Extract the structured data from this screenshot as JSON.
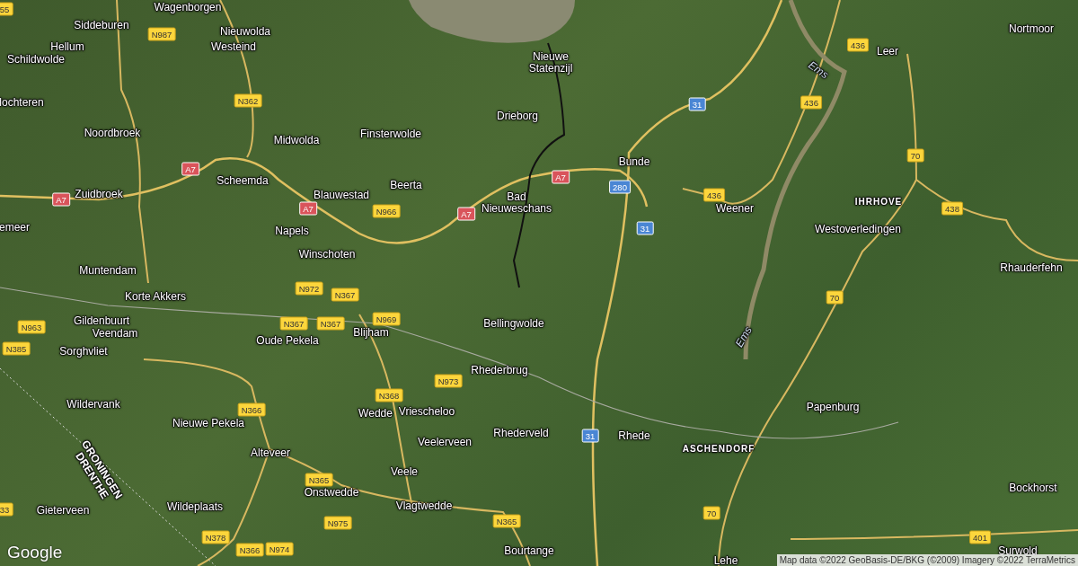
{
  "map": {
    "labels": [
      {
        "kind": "place",
        "text": "Wagenborgen"
      },
      {
        "kind": "place",
        "text": "Siddeburen"
      },
      {
        "kind": "place",
        "text": "Hellum"
      },
      {
        "kind": "place",
        "text": "Schildwolde"
      },
      {
        "kind": "place",
        "text": "lochteren"
      },
      {
        "kind": "place",
        "text": "Noordbroek"
      },
      {
        "kind": "place",
        "text": "Nieuwolda"
      },
      {
        "kind": "place",
        "text": "Westeind"
      },
      {
        "kind": "place",
        "text": "Midwolda"
      },
      {
        "kind": "place",
        "text": "Scheemda"
      },
      {
        "kind": "place",
        "text": "Zuidbroek"
      },
      {
        "kind": "place",
        "text": "Blauwestad"
      },
      {
        "kind": "place",
        "text": "emeer"
      },
      {
        "kind": "place",
        "text": "Napels"
      },
      {
        "kind": "place",
        "text": "Winschoten"
      },
      {
        "kind": "place",
        "text": "Muntendam"
      },
      {
        "kind": "place",
        "text": "Finsterwolde"
      },
      {
        "kind": "place",
        "text": "Drieborg"
      },
      {
        "kind": "place",
        "text": "Nieuwe Statenzijl"
      },
      {
        "kind": "place",
        "text": "Bad Nieuweschans"
      },
      {
        "kind": "place",
        "text": "Beerta"
      },
      {
        "kind": "place",
        "text": "Bunde"
      },
      {
        "kind": "place",
        "text": "Weener"
      },
      {
        "kind": "place",
        "text": "Leer"
      },
      {
        "kind": "place",
        "text": "Nortmoor"
      },
      {
        "kind": "place",
        "text": "Westoverledingen"
      },
      {
        "kind": "place",
        "text": "Rhauderfehn"
      },
      {
        "kind": "place",
        "text": "Korte Akkers"
      },
      {
        "kind": "place",
        "text": "Gildenbuurt"
      },
      {
        "kind": "place",
        "text": "Veendam"
      },
      {
        "kind": "place",
        "text": "Sorghvliet"
      },
      {
        "kind": "place",
        "text": "Oude Pekela"
      },
      {
        "kind": "place",
        "text": "Blijham"
      },
      {
        "kind": "place",
        "text": "Bellingwolde"
      },
      {
        "kind": "place",
        "text": "Wildervank"
      },
      {
        "kind": "place",
        "text": "Nieuwe Pekela"
      },
      {
        "kind": "place",
        "text": "Rhederbrug"
      },
      {
        "kind": "place",
        "text": "Wedde"
      },
      {
        "kind": "place",
        "text": "Vriescheloo"
      },
      {
        "kind": "place",
        "text": "Veelerveen"
      },
      {
        "kind": "place",
        "text": "Rhederveld"
      },
      {
        "kind": "place",
        "text": "Rhede"
      },
      {
        "kind": "place",
        "text": "Alteveer"
      },
      {
        "kind": "place",
        "text": "Veele"
      },
      {
        "kind": "place",
        "text": "Onstwedde"
      },
      {
        "kind": "place",
        "text": "Gieterveen"
      },
      {
        "kind": "place",
        "text": "Wildeplaats"
      },
      {
        "kind": "place",
        "text": "Vlagtwedde"
      },
      {
        "kind": "place",
        "text": "Bourtange"
      },
      {
        "kind": "place",
        "text": "Papenburg"
      },
      {
        "kind": "place",
        "text": "Bockhorst"
      },
      {
        "kind": "place",
        "text": "Surwold"
      },
      {
        "kind": "place",
        "text": "Lehe"
      },
      {
        "kind": "district",
        "text": "IHRHOVE"
      },
      {
        "kind": "district",
        "text": "ASCHENDORF"
      },
      {
        "kind": "water",
        "text": "Ems"
      },
      {
        "kind": "water",
        "text": "Ems"
      },
      {
        "kind": "border",
        "text": "GRONINGEN DRENTHE"
      }
    ],
    "shields": [
      {
        "kind": "regional",
        "text": "55"
      },
      {
        "kind": "regional",
        "text": "N987"
      },
      {
        "kind": "regional",
        "text": "N362"
      },
      {
        "kind": "regional",
        "text": "N966"
      },
      {
        "kind": "regional",
        "text": "436"
      },
      {
        "kind": "regional",
        "text": "436"
      },
      {
        "kind": "regional",
        "text": "70"
      },
      {
        "kind": "regional",
        "text": "438"
      },
      {
        "kind": "regional",
        "text": "436"
      },
      {
        "kind": "regional",
        "text": "70"
      },
      {
        "kind": "regional",
        "text": "N963"
      },
      {
        "kind": "regional",
        "text": "N385"
      },
      {
        "kind": "regional",
        "text": "N972"
      },
      {
        "kind": "regional",
        "text": "N367"
      },
      {
        "kind": "regional",
        "text": "N367"
      },
      {
        "kind": "regional",
        "text": "N367"
      },
      {
        "kind": "regional",
        "text": "N969"
      },
      {
        "kind": "regional",
        "text": "N973"
      },
      {
        "kind": "regional",
        "text": "N368"
      },
      {
        "kind": "regional",
        "text": "N366"
      },
      {
        "kind": "regional",
        "text": "N365"
      },
      {
        "kind": "regional",
        "text": "N975"
      },
      {
        "kind": "regional",
        "text": "N378"
      },
      {
        "kind": "regional",
        "text": "N366"
      },
      {
        "kind": "regional",
        "text": "N974"
      },
      {
        "kind": "regional",
        "text": "N365"
      },
      {
        "kind": "regional",
        "text": "70"
      },
      {
        "kind": "regional",
        "text": "401"
      },
      {
        "kind": "regional",
        "text": "33"
      },
      {
        "kind": "motorway",
        "text": "A7"
      },
      {
        "kind": "motorway",
        "text": "A7"
      },
      {
        "kind": "motorway",
        "text": "A7"
      },
      {
        "kind": "motorway",
        "text": "A7"
      },
      {
        "kind": "motorway",
        "text": "A7"
      },
      {
        "kind": "autobahn",
        "text": "31"
      },
      {
        "kind": "autobahn",
        "text": "280"
      },
      {
        "kind": "autobahn",
        "text": "31"
      },
      {
        "kind": "autobahn",
        "text": "31"
      }
    ]
  },
  "logo": {
    "text": "Google"
  },
  "attribution": "Map data ©2022 GeoBasis-DE/BKG (©2009) Imagery ©2022 TerraMetrics"
}
